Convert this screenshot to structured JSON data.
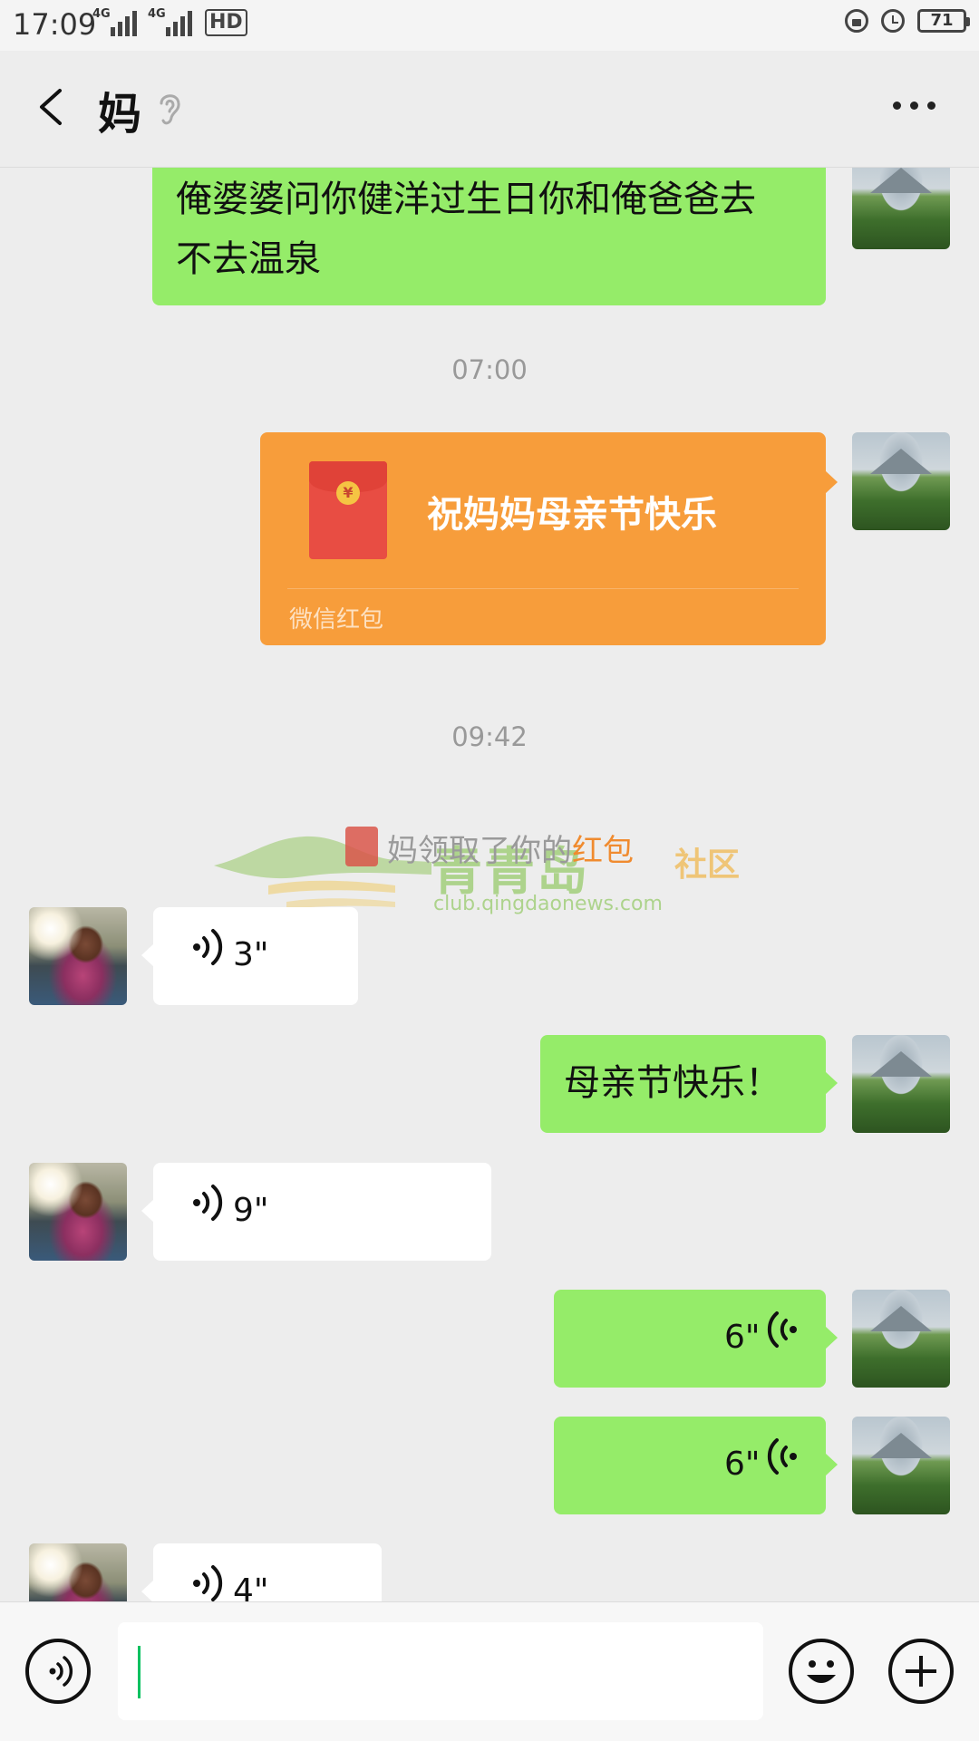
{
  "status_bar": {
    "time": "17:09",
    "network_1": "4G",
    "network_2": "4G",
    "hd_label": "HD",
    "battery": "71",
    "icons": [
      "lock-rotation-icon",
      "alarm-icon",
      "battery-icon"
    ]
  },
  "header": {
    "title": "妈",
    "back_icon": "chevron-left-icon",
    "mode_icon": "ear-icon",
    "more_icon": "more-dots-icon"
  },
  "messages": {
    "m1_text_line1": "俺婆婆问你健洋过生日你和俺爸爸去",
    "m1_text_line2": "不去温泉",
    "ts1": "07:00",
    "red_packet": {
      "title": "祝妈妈母亲节快乐",
      "label": "微信红包",
      "coin": "¥"
    },
    "ts2": "09:42",
    "system_prefix": "妈领取了你的",
    "system_highlight": "红包",
    "voice1": "3\"",
    "m2_text": "母亲节快乐！",
    "voice2": "9\"",
    "voice3": "6\"",
    "voice4": "6\"",
    "voice5": "4\""
  },
  "watermark": {
    "text": "青青岛",
    "text2": "社区",
    "url": "club.qingdaonews.com"
  },
  "input_bar": {
    "value": "",
    "voice_icon": "voice-toggle-icon",
    "emoji_icon": "emoji-icon",
    "plus_icon": "plus-icon"
  },
  "colors": {
    "self_bubble": "#95ec69",
    "other_bubble": "#ffffff",
    "red_packet": "#f79d3b",
    "background": "#ededed",
    "cursor": "#07c160"
  }
}
